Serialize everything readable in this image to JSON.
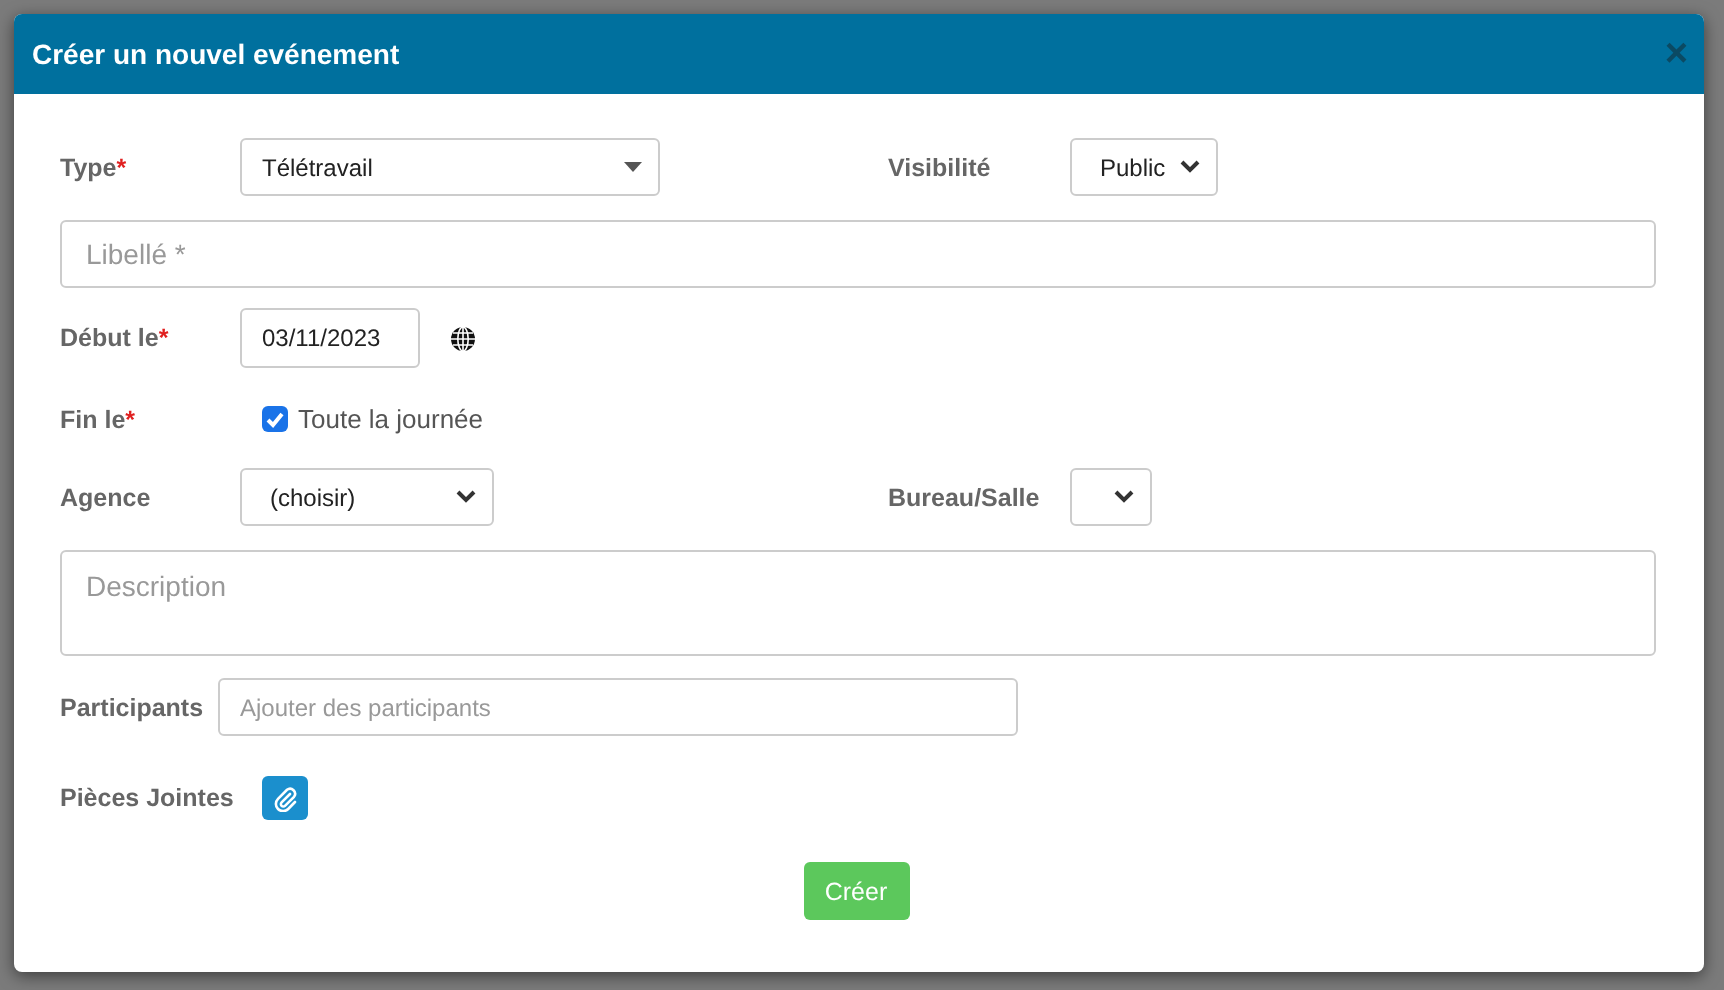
{
  "dialog": {
    "title": "Créer un nouvel evénement",
    "close": "×"
  },
  "type": {
    "label": "Type",
    "mark": "*",
    "value": "Télétravail"
  },
  "visibility": {
    "label": "Visibilité",
    "value": "Public"
  },
  "title_field": {
    "placeholder": "Libellé *"
  },
  "start": {
    "label": "Début le",
    "mark": "*",
    "value": "03/11/2023"
  },
  "end": {
    "label": "Fin le",
    "mark": "*",
    "all_day": {
      "label": "Toute la journée",
      "checked": true
    }
  },
  "agency": {
    "label": "Agence",
    "value": "(choisir)"
  },
  "room": {
    "label": "Bureau/Salle"
  },
  "description": {
    "placeholder": "Description"
  },
  "participants": {
    "label": "Participants",
    "placeholder": "Ajouter des participants"
  },
  "attachments": {
    "label": "Pièces Jointes"
  },
  "submit": "Créer"
}
